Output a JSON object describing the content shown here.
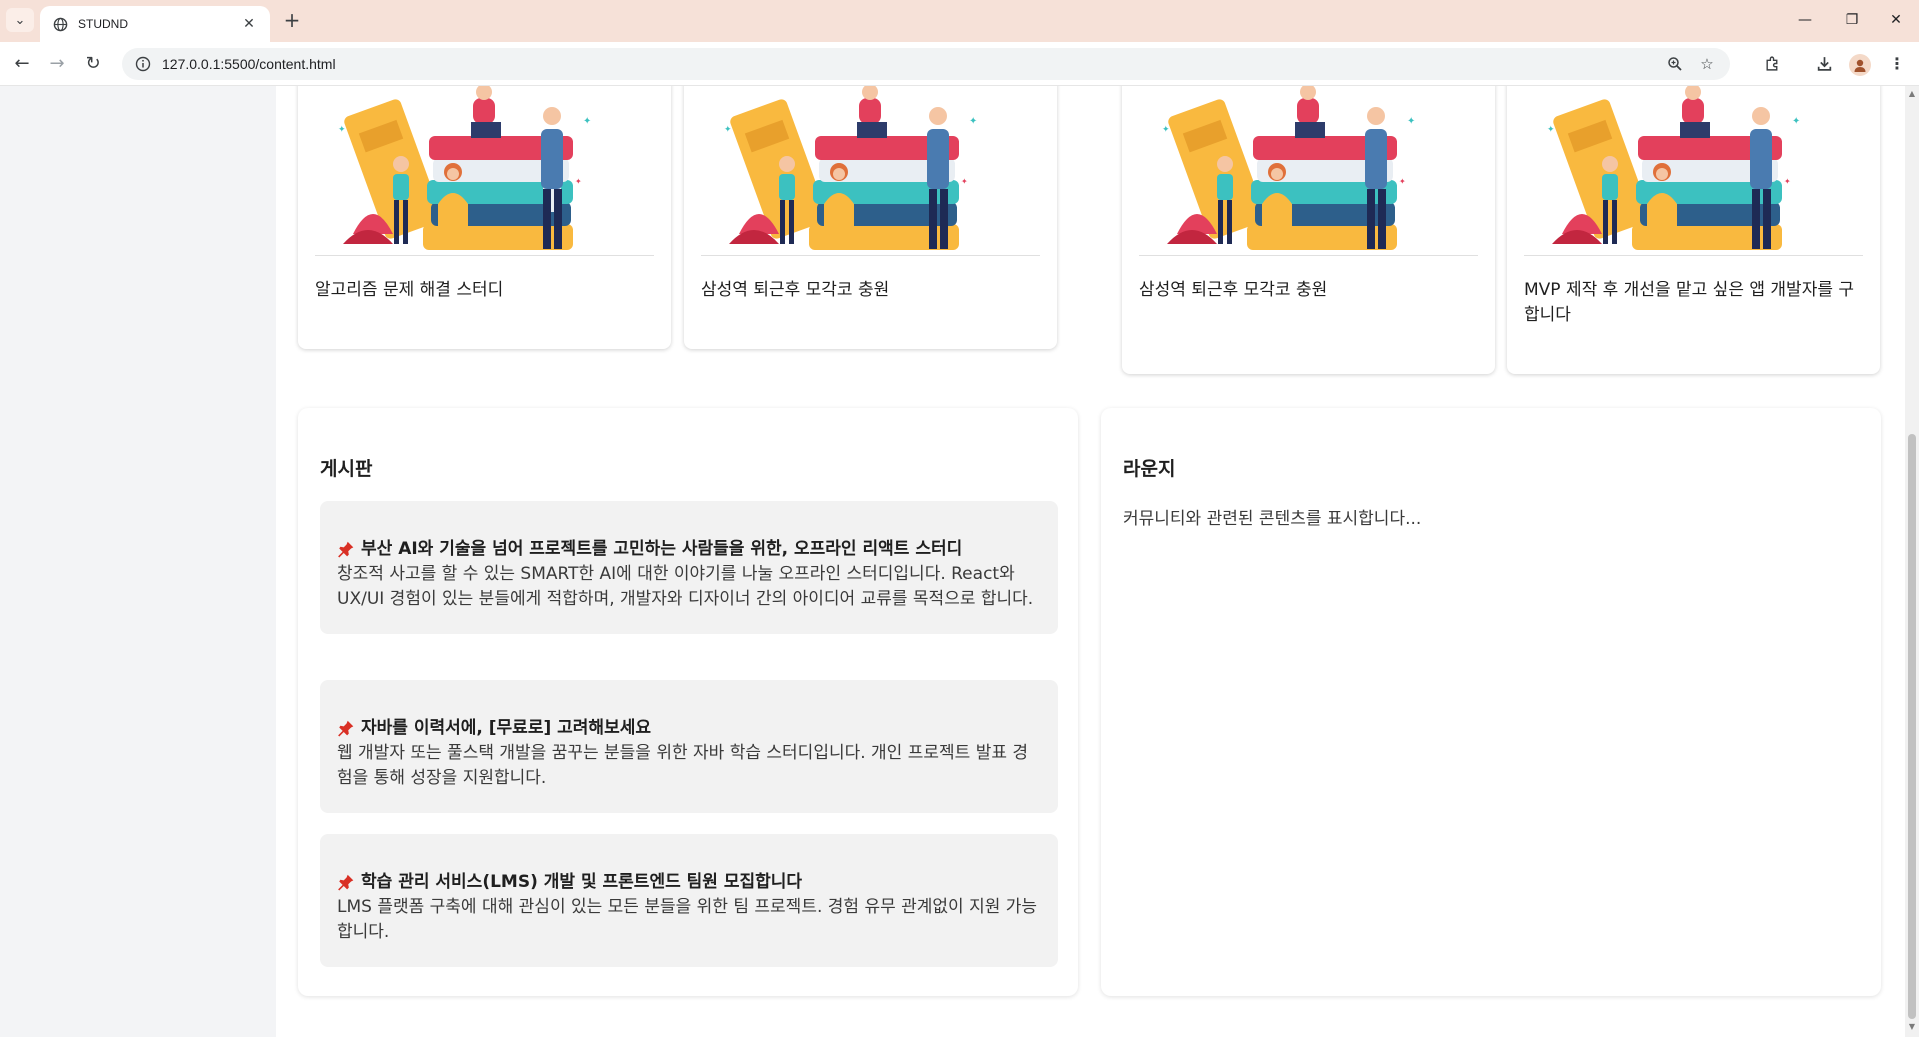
{
  "browser": {
    "tab_title": "STUDND",
    "url": "127.0.0.1:5500/content.html",
    "icons": [
      "tab-list-icon",
      "globe-icon",
      "close-icon",
      "plus-icon",
      "minimize-icon",
      "restore-icon",
      "window-close-icon",
      "back-icon",
      "forward-icon",
      "reload-icon",
      "site-info-icon",
      "zoom-icon",
      "star-icon",
      "extensions-icon",
      "download-icon",
      "avatar-icon",
      "menu-icon"
    ]
  },
  "cards": [
    {
      "title": "알고리즘 문제 해결 스터디"
    },
    {
      "title": "삼성역 퇴근후 모각코 충원"
    },
    {
      "title": "삼성역 퇴근후 모각코 충원"
    },
    {
      "title": "MVP 제작 후 개선을 맡고 싶은 앱 개발자를 구합니다"
    }
  ],
  "board": {
    "title": "게시판",
    "posts": [
      {
        "title": "부산 AI와 기술을 넘어 프로젝트를 고민하는 사람들을 위한, 오프라인 리액트 스터디",
        "body": "창조적 사고를 할 수 있는 SMART한 AI에 대한 이야기를 나눌 오프라인 스터디입니다. React와 UX/UI 경험이 있는 분들에게 적합하며, 개발자와 디자이너 간의 아이디어 교류를 목적으로 합니다."
      },
      {
        "title": "자바를 이력서에, [무료로] 고려해보세요",
        "body": "웹 개발자 또는 풀스택 개발을 꿈꾸는 분들을 위한 자바 학습 스터디입니다. 개인 프로젝트 발표 경험을 통해 성장을 지원합니다."
      },
      {
        "title": "학습 관리 서비스(LMS) 개발 및 프론트엔드 팀원 모집합니다",
        "body": "LMS 플랫폼 구축에 대해 관심이 있는 모든 분들을 위한 팀 프로젝트. 경험 유무 관계없이 지원 가능합니다."
      }
    ]
  },
  "lounge": {
    "title": "라운지",
    "text": "커뮤니티와 관련된 콘텐츠를 표시합니다..."
  },
  "colors": {
    "tabstrip": "#f6e1d8",
    "pin": "#d93025",
    "post_bg": "#f2f2f2",
    "sidebar_bg": "#f3f4f6"
  }
}
